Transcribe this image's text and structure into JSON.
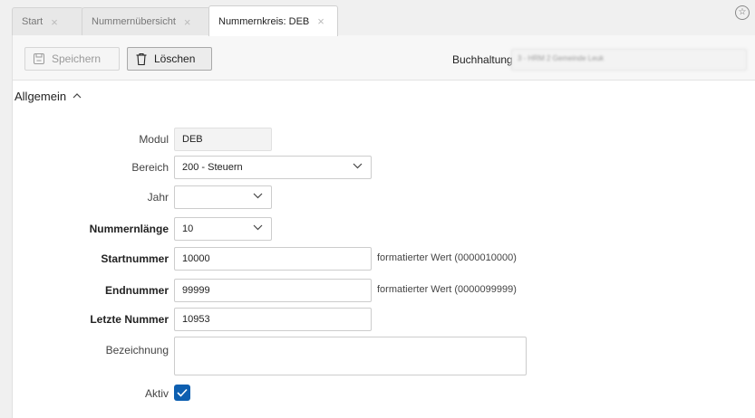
{
  "tabs": [
    {
      "label": "Start"
    },
    {
      "label": "Nummernübersicht"
    },
    {
      "label": "Nummernkreis: DEB"
    }
  ],
  "tab_close_glyph": "×",
  "toolbar": {
    "save_label": "Speichern",
    "delete_label": "Löschen",
    "buchhaltung_label": "Buchhaltung",
    "buchhaltung_value": "3 - HRM 2 Gemeinde Leuk"
  },
  "section": {
    "title": "Allgemein"
  },
  "form": {
    "modul": {
      "label": "Modul",
      "value": "DEB"
    },
    "bereich": {
      "label": "Bereich",
      "value": "200 - Steuern"
    },
    "jahr": {
      "label": "Jahr",
      "value": ""
    },
    "nummernlaenge": {
      "label": "Nummernlänge",
      "value": "10"
    },
    "startnummer": {
      "label": "Startnummer",
      "value": "10000",
      "hint": "formatierter Wert (0000010000)"
    },
    "endnummer": {
      "label": "Endnummer",
      "value": "99999",
      "hint": "formatierter Wert (0000099999)"
    },
    "letzte_nummer": {
      "label": "Letzte Nummer",
      "value": "10953"
    },
    "bezeichnung": {
      "label": "Bezeichnung",
      "value": ""
    },
    "aktiv": {
      "label": "Aktiv",
      "checked": true
    }
  },
  "icons": [
    "save-icon",
    "trash-icon",
    "chevron-up-icon",
    "chevron-down-icon",
    "star-icon",
    "close-icon",
    "checkmark-icon"
  ],
  "colors": {
    "accent": "#0d5fb0"
  }
}
